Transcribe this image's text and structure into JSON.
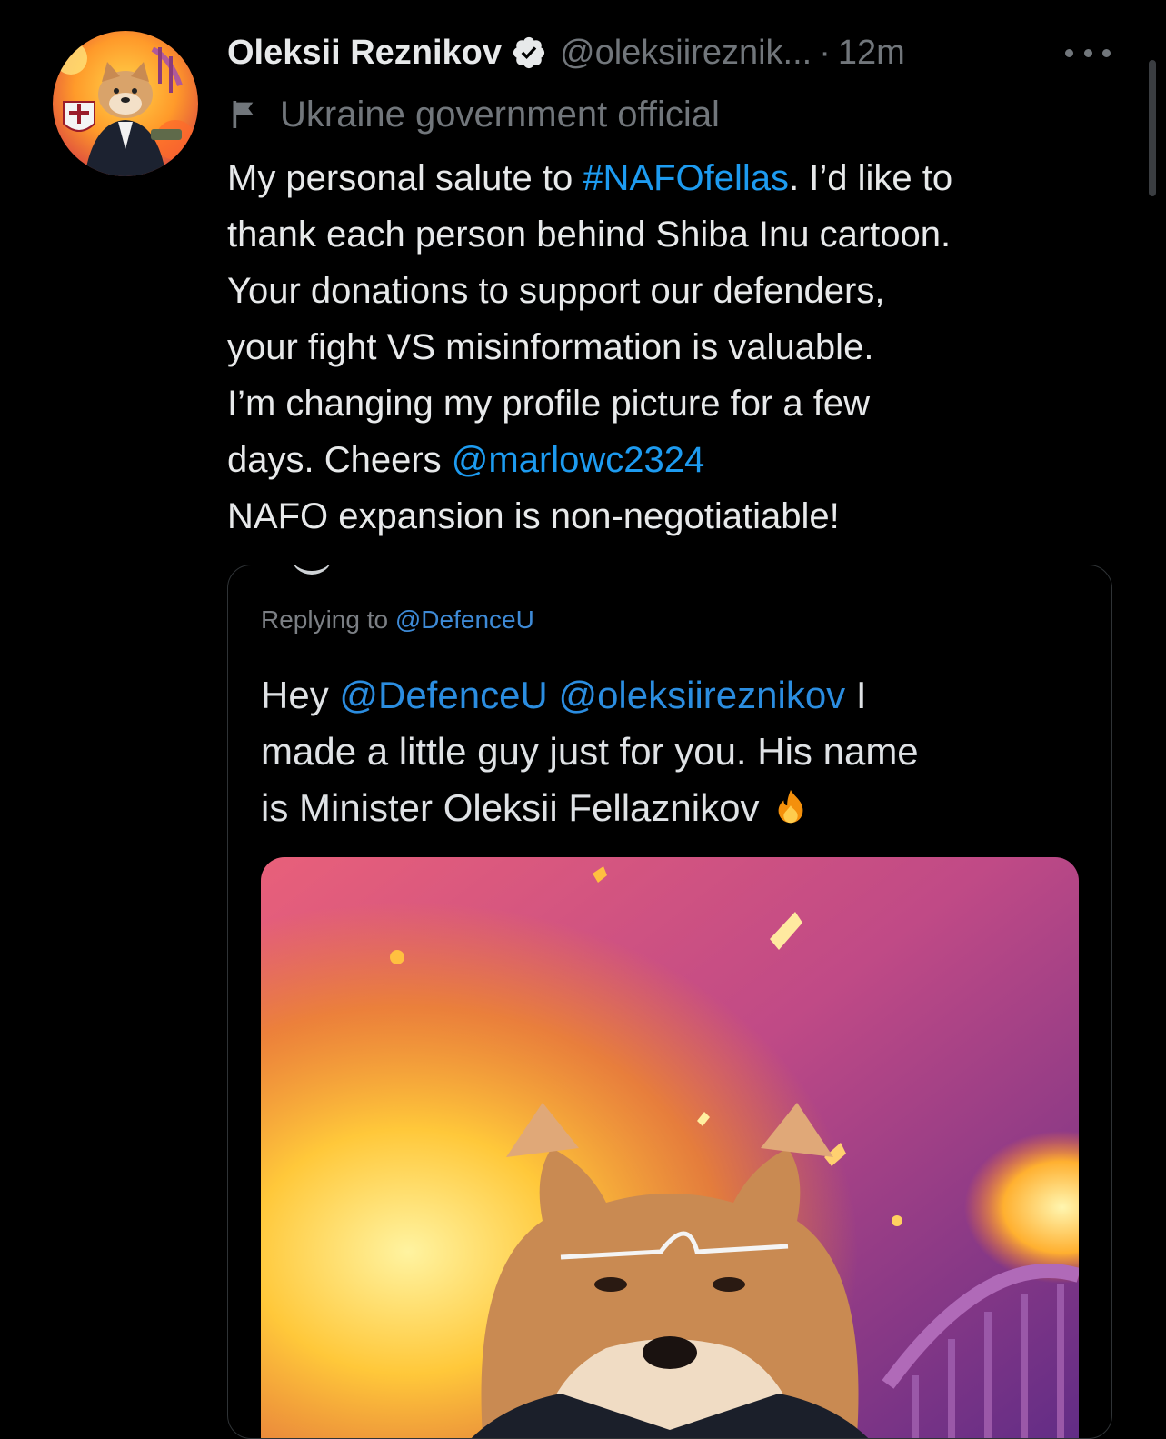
{
  "tweet": {
    "author_name": "Oleksii Reznikov",
    "author_handle": "@oleksiireznik...",
    "separator": "·",
    "time": "12m",
    "label": "Ukraine government official",
    "text_lines": [
      {
        "pre": "My personal salute to ",
        "link": "#NAFOfellas",
        "post": ". I’d like to"
      },
      {
        "pre": "thank each person behind Shiba Inu cartoon.",
        "link": "",
        "post": ""
      },
      {
        "pre": "Your donations to support our defenders,",
        "link": "",
        "post": ""
      },
      {
        "pre": "your fight VS misinformation is valuable.",
        "link": "",
        "post": ""
      },
      {
        "pre": "I’m changing my profile picture for a few",
        "link": "",
        "post": ""
      },
      {
        "pre": "days. Cheers ",
        "link": "@marlowc2324",
        "post": ""
      },
      {
        "pre": "NAFO expansion is non-negotiatiable!",
        "link": "",
        "post": ""
      }
    ]
  },
  "quote": {
    "replying_prefix": "Replying to ",
    "replying_handle": "@DefenceU",
    "line1_pre": "Hey ",
    "line1_link1": "@DefenceU",
    "line1_space": " ",
    "line1_link2": "@oleksiireznikov",
    "line1_post": " I",
    "line2": "made a little guy just for you. His name",
    "line3": "is Minister Oleksii Fellaznikov"
  },
  "icons": {
    "verified": "verified-badge-icon",
    "label_flag": "flag-icon",
    "more": "more-options-icon",
    "fire": "fire-emoji-icon"
  },
  "colors": {
    "background": "#000000",
    "text": "#e7e9ea",
    "secondary": "#71767b",
    "link": "#1d9bf0"
  }
}
